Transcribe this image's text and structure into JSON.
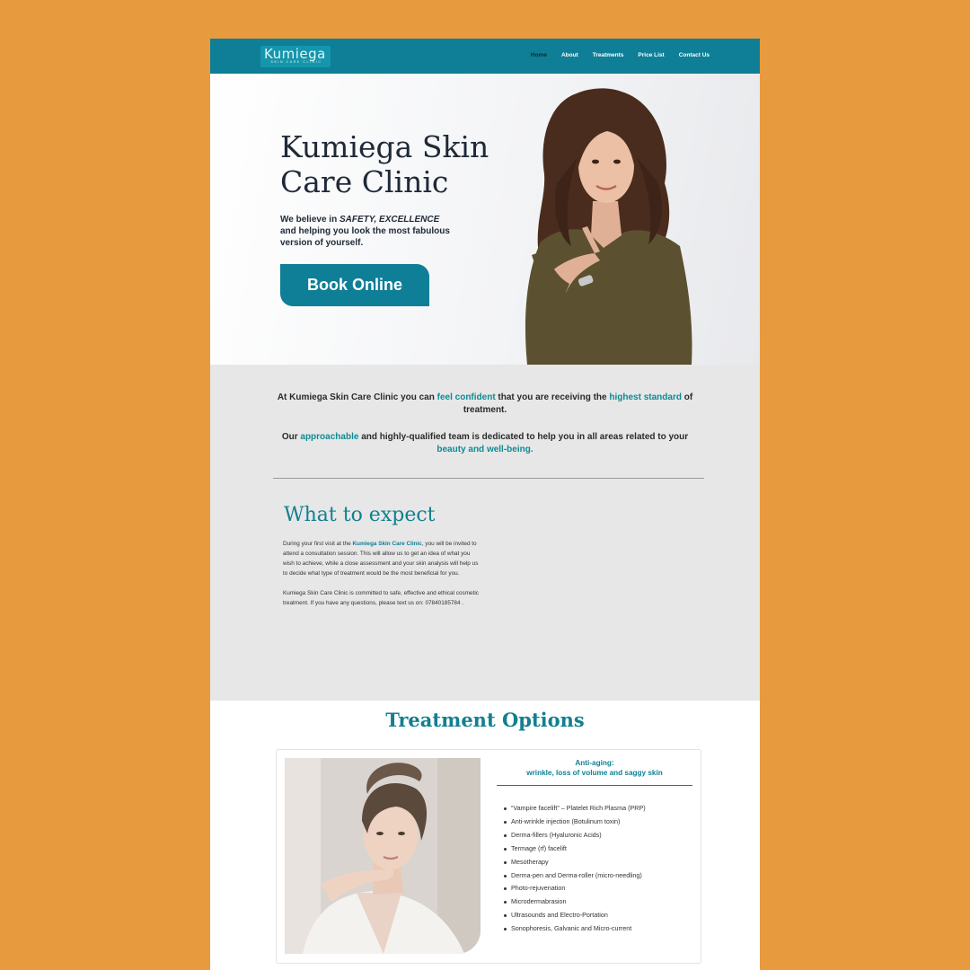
{
  "brand": {
    "logo_name": "Kumiega",
    "logo_tagline": "SKIN CARE CLINIC"
  },
  "nav": {
    "items": [
      {
        "label": "Home",
        "active": true
      },
      {
        "label": "About"
      },
      {
        "label": "Treatments"
      },
      {
        "label": "Price List"
      },
      {
        "label": "Contact Us"
      }
    ]
  },
  "hero": {
    "title": "Kumiega Skin Care Clinic",
    "text_lead": "We believe in ",
    "text_em": "SAFETY, EXCELLENCE",
    "text_rest": "and helping you look the most fabulous version of yourself.",
    "button": "Book Online"
  },
  "intro": {
    "p1_a": "At Kumiega Skin Care Clinic you can ",
    "p1_hl1": "feel confident",
    "p1_b": " that you are receiving the ",
    "p1_hl2": "highest standard",
    "p1_c": " of treatment.",
    "p2_a": "Our ",
    "p2_hl1": "approachable",
    "p2_b": " and highly-qualified team is dedicated to help you in all areas related to your ",
    "p2_hl2": "beauty and well-being."
  },
  "expect": {
    "title": "What to expect",
    "p1_a": "During your first visit at the ",
    "p1_bold": "Kumiega Skin Care Clinic",
    "p1_b": ", you will be invited to attend a consultation session. This will allow us to get an idea of what you wish to achieve, while a close assessment and your skin analysis will help us to decide what type of treatment would be the most beneficial for you.",
    "p2": "Kumiega Skin Care Clinic is committed to safe, effective and ethical cosmetic treatment. If you have any questions, please text us on: 07840185784 ."
  },
  "treatments": {
    "title": "Treatment Options",
    "card": {
      "heading_1": "Anti-aging:",
      "heading_2": "wrinkle, loss of volume and saggy skin",
      "items": [
        "“Vampire facelift” – Platelet Rich Plasma (PRP)",
        "Anti-wrinkle injection (Botulinum toxin)",
        "Derma-fillers (Hyaluronic Acids)",
        "Termage (rf) facelift",
        "Mesotherapy",
        "Derma-pen and Derma-roller (micro-needling)",
        "Photo-rejuvenation",
        "Microdermabrasion",
        "Ultrasounds and Electro-Portation",
        "Sonophoresis, Galvanic and Micro-current"
      ]
    }
  },
  "colors": {
    "background": "#E89A3E",
    "teal": "#0E7F96",
    "accent_text": "#0E8A94"
  }
}
